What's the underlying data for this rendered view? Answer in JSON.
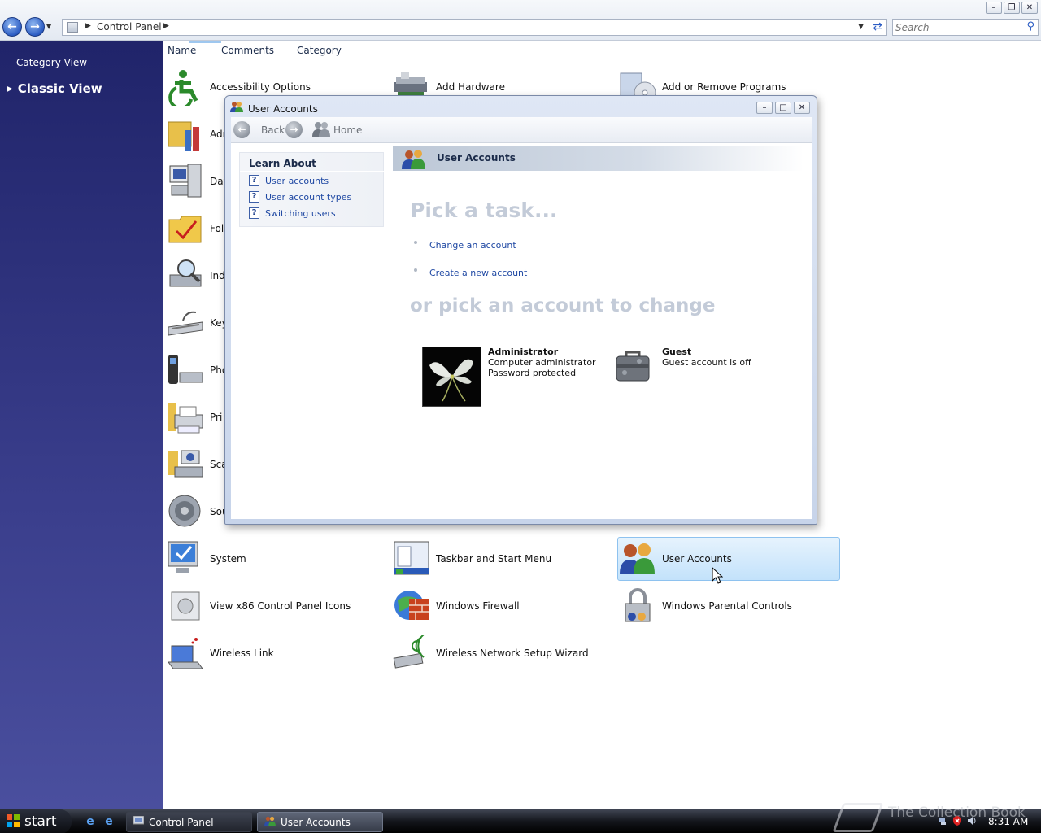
{
  "explorer": {
    "address_path": "Control Panel",
    "search_placeholder": "Search"
  },
  "left_pane": {
    "category_view": "Category View",
    "classic_view": "Classic View"
  },
  "columns": {
    "name": "Name",
    "comments": "Comments",
    "category": "Category"
  },
  "items": {
    "accessibility": "Accessibility Options",
    "add_hardware": "Add Hardware",
    "add_remove": "Add or Remove Programs",
    "adm": "Adm",
    "dat": "Dat",
    "fol": "Fol",
    "ind": "Ind",
    "key": "Key",
    "pho": "Pho",
    "pri": "Pri",
    "sca": "Sca",
    "sou": "Sou",
    "system": "System",
    "taskbar": "Taskbar and Start Menu",
    "user_accounts": "User Accounts",
    "view_x86": "View x86 Control Panel Icons",
    "firewall": "Windows Firewall",
    "parental": "Windows Parental Controls",
    "wireless_link": "Wireless Link",
    "wireless_wizard": "Wireless Network Setup Wizard"
  },
  "ua_window": {
    "title": "User Accounts",
    "back": "Back",
    "home": "Home",
    "learn_about": "Learn About",
    "learn_links": [
      "User accounts",
      "User account types",
      "Switching users"
    ],
    "header": "User Accounts",
    "pick_task": "Pick a task...",
    "tasks": [
      "Change an account",
      "Create a new account"
    ],
    "pick_account": "or pick an account to change",
    "admin": {
      "name": "Administrator",
      "role": "Computer administrator",
      "status": "Password protected"
    },
    "guest": {
      "name": "Guest",
      "status": "Guest account is off"
    }
  },
  "taskbar": {
    "start": "start",
    "tasks": [
      "Control Panel",
      "User Accounts"
    ],
    "watermark": "The Collection Book",
    "clock": "8:31 AM"
  }
}
